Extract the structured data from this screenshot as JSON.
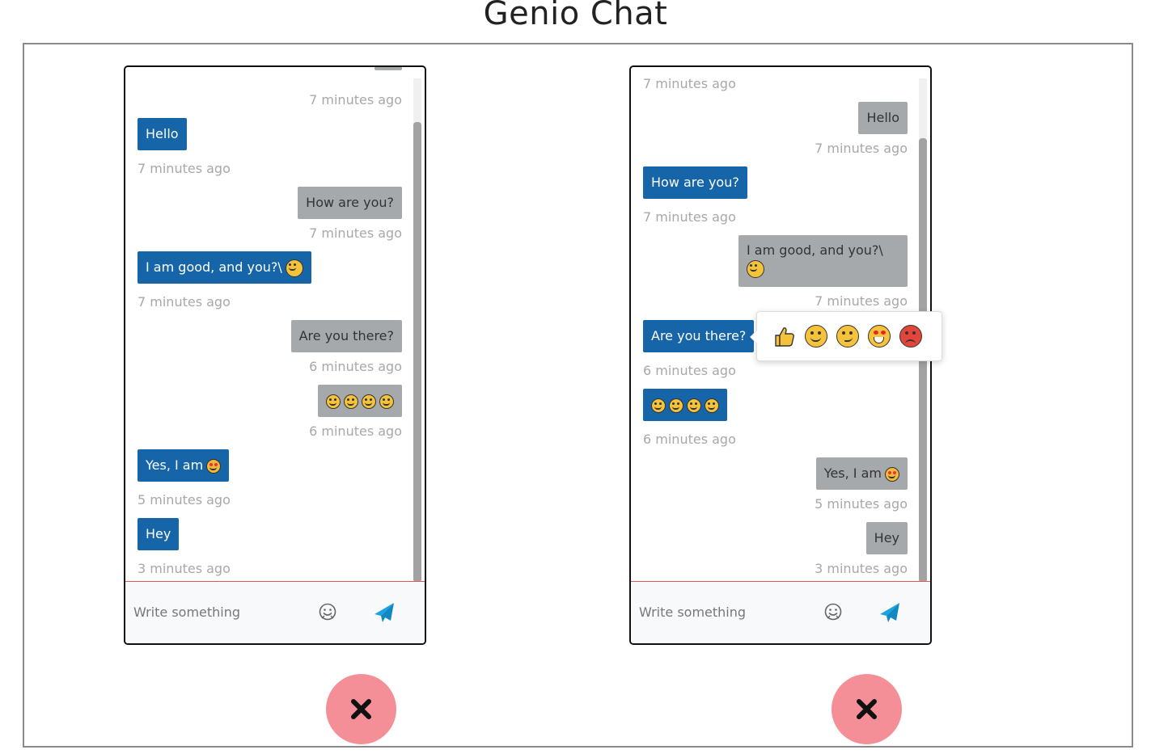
{
  "title": "Genio Chat",
  "chats": [
    {
      "messages": [
        {
          "side": "left",
          "text": "Hello",
          "time": "7 minutes ago"
        },
        {
          "side": "right",
          "text": "How are you?",
          "time": "7 minutes ago"
        },
        {
          "side": "left",
          "text": "I am good, and you?\\",
          "time": "7 minutes ago"
        },
        {
          "side": "right",
          "text": "Are you there?",
          "time": "6 minutes ago"
        },
        {
          "side": "right",
          "text": "",
          "time": "6 minutes ago"
        },
        {
          "side": "left",
          "text": "Yes, I am",
          "time": "5 minutes ago"
        },
        {
          "side": "left",
          "text": "Hey",
          "time": "3 minutes ago"
        }
      ],
      "top_time": "7 minutes ago",
      "composer": {
        "placeholder": "Write something"
      }
    },
    {
      "messages": [
        {
          "side": "right",
          "text": "Hello",
          "time": "7 minutes ago"
        },
        {
          "side": "left",
          "text": "How are you?",
          "time": "7 minutes ago"
        },
        {
          "side": "right",
          "text": "I am good, and you?\\",
          "time": "7 minutes ago"
        },
        {
          "side": "left",
          "text": "Are you there?",
          "time": "6 minutes ago"
        },
        {
          "side": "left",
          "text": "",
          "time": "6 minutes ago"
        },
        {
          "side": "right",
          "text": "Yes, I am",
          "time": "5 minutes ago"
        },
        {
          "side": "right",
          "text": "Hey",
          "time": "3 minutes ago"
        }
      ],
      "top_time": "7 minutes ago",
      "composer": {
        "placeholder": "Write something"
      }
    }
  ],
  "reactions": [
    "thumbs-up",
    "grinning",
    "smirk",
    "heart-eyes",
    "angry"
  ],
  "colors": {
    "own_bubble": "#1565a8",
    "other_bubble": "#a6a9ac",
    "close_button": "#f48f98",
    "send_icon": "#1aa3e0"
  },
  "icons": {
    "emoji": "smiley-face-icon",
    "send": "paper-plane-icon",
    "close": "x-icon"
  }
}
